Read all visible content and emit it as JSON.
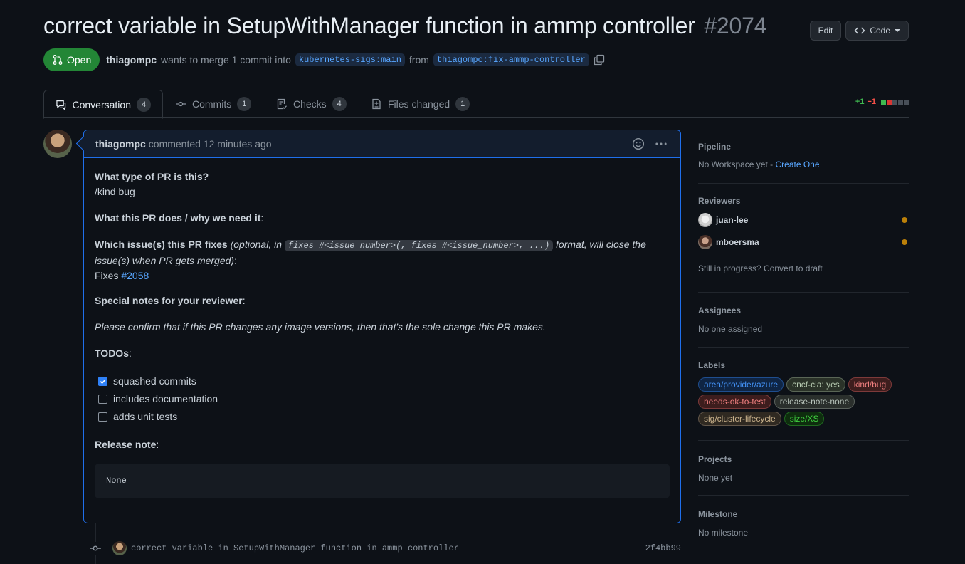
{
  "pr": {
    "title": "correct variable in SetupWithManager function in ammp controller",
    "number": "#2074",
    "state": "Open",
    "author": "thiagompc",
    "merge_text": "wants to merge 1 commit into",
    "base_branch": "kubernetes-sigs:main",
    "from_text": "from",
    "head_branch": "thiagompc:fix-ammp-controller"
  },
  "header_buttons": {
    "edit": "Edit",
    "code": "Code"
  },
  "tabs": [
    {
      "label": "Conversation",
      "count": "4"
    },
    {
      "label": "Commits",
      "count": "1"
    },
    {
      "label": "Checks",
      "count": "4"
    },
    {
      "label": "Files changed",
      "count": "1"
    }
  ],
  "diffstat": {
    "additions": "+1",
    "deletions": "−1"
  },
  "comment": {
    "author": "thiagompc",
    "action": "commented 12 minutes ago",
    "q1": "What type of PR is this?",
    "kind": "/kind bug",
    "q2": "What this PR does / why we need it",
    "q2_colon": ":",
    "q3": "Which issue(s) this PR fixes",
    "q3_note_a": "(optional, in",
    "q3_code": "fixes #<issue number>(, fixes #<issue_number>, ...)",
    "q3_note_b": "format, will close the",
    "q3_note_c": "issue(s) when PR gets merged)",
    "q3_colon": ":",
    "fixes_label": "Fixes",
    "fixes_link": "#2058",
    "q4": "Special notes for your reviewer",
    "q4_colon": ":",
    "note": "Please confirm that if this PR changes any image versions, then that's the sole change this PR makes.",
    "q5": "TODOs",
    "q5_colon": ":",
    "todos": [
      {
        "label": "squashed commits",
        "checked": true
      },
      {
        "label": "includes documentation",
        "checked": false
      },
      {
        "label": "adds unit tests",
        "checked": false
      }
    ],
    "q6": "Release note",
    "q6_colon": ":",
    "release_note": "None"
  },
  "commit": {
    "message": "correct variable in SetupWithManager function in ammp controller",
    "sha": "2f4bb99"
  },
  "sidebar": {
    "pipeline": {
      "title": "Pipeline",
      "text": "No Workspace yet - ",
      "link": "Create One"
    },
    "reviewers": {
      "title": "Reviewers",
      "items": [
        "juan-lee",
        "mboersma"
      ],
      "draft_text": "Still in progress? Convert to draft"
    },
    "assignees": {
      "title": "Assignees",
      "text": "No one assigned"
    },
    "labels": {
      "title": "Labels",
      "items": [
        {
          "name": "area/provider/azure",
          "color": "#4493f8"
        },
        {
          "name": "cncf-cla: yes",
          "color": "#b7cbb1"
        },
        {
          "name": "kind/bug",
          "color": "#f07f7f"
        },
        {
          "name": "needs-ok-to-test",
          "color": "#f07f7f"
        },
        {
          "name": "release-note-none",
          "color": "#b8c4bb"
        },
        {
          "name": "sig/cluster-lifecycle",
          "color": "#c9b28c"
        },
        {
          "name": "size/XS",
          "color": "#3fce3f"
        }
      ]
    },
    "projects": {
      "title": "Projects",
      "text": "None yet"
    },
    "milestone": {
      "title": "Milestone",
      "text": "No milestone"
    }
  },
  "colors": {
    "accent": "#1f6feb",
    "open": "#238636",
    "bg": "#0d1117"
  }
}
